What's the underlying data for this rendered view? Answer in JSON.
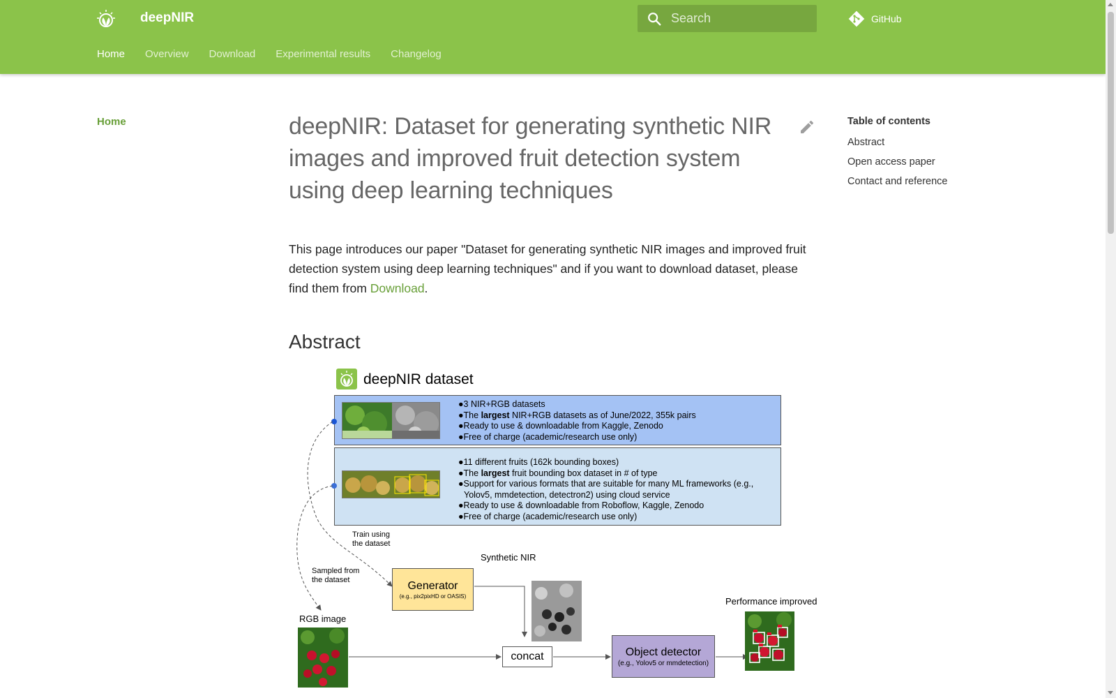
{
  "header": {
    "site_title": "deepNIR",
    "search_placeholder": "Search",
    "github_label": "GitHub",
    "tabs": [
      {
        "label": "Home",
        "active": true
      },
      {
        "label": "Overview",
        "active": false
      },
      {
        "label": "Download",
        "active": false
      },
      {
        "label": "Experimental results",
        "active": false
      },
      {
        "label": "Changelog",
        "active": false
      }
    ]
  },
  "nav": {
    "home_label": "Home"
  },
  "main": {
    "title": "deepNIR: Dataset for generating synthetic NIR images and improved fruit detection system using deep learning techniques",
    "intro_text": "This page introduces our paper \"Dataset for generating synthetic NIR images and improved fruit detection system using deep learning techniques\" and if you want to download dataset, please find them from ",
    "intro_link": "Download",
    "intro_end": ".",
    "abstract_heading": "Abstract"
  },
  "figure": {
    "title": "deepNIR dataset",
    "box1": [
      {
        "pre": "●3 NIR+RGB datasets",
        "bold": "",
        "post": ""
      },
      {
        "pre": "●The ",
        "bold": "largest",
        "post": " NIR+RGB datasets as of June/2022, 355k pairs"
      },
      {
        "pre": "●Ready to use & downloadable from Kaggle, Zenodo",
        "bold": "",
        "post": ""
      },
      {
        "pre": "●Free of charge (academic/research use only)",
        "bold": "",
        "post": ""
      }
    ],
    "box2": [
      {
        "pre": "●11 different fruits (162k bounding boxes)",
        "bold": "",
        "post": ""
      },
      {
        "pre": "●The ",
        "bold": "largest",
        "post": " fruit bounding box dataset in # of type"
      },
      {
        "pre": "●Support for various formats that are suitable for many ML frameworks (e.g.,",
        "bold": "",
        "post": ""
      },
      {
        "pre": "  Yolov5, mmdetection, detectron2) using cloud service",
        "bold": "",
        "post": ""
      },
      {
        "pre": "●Ready to use & downloadable from Roboflow, Kaggle, Zenodo",
        "bold": "",
        "post": ""
      },
      {
        "pre": "●Free of charge (academic/research use only)",
        "bold": "",
        "post": ""
      }
    ],
    "train_label_1": "Train using",
    "train_label_2": "the dataset",
    "sampled_label_1": "Sampled from",
    "sampled_label_2": "the dataset",
    "synthetic_label": "Synthetic NIR",
    "generator_title": "Generator",
    "generator_sub": "(e.g., pix2pixHD or OASIS)",
    "rgb_label": "RGB image",
    "concat_label": "concat",
    "detector_title": "Object detector",
    "detector_sub": "(e.g., Yolov5 or mmdetection)",
    "performance_label": "Performance improved"
  },
  "toc": {
    "title": "Table of contents",
    "items": [
      "Abstract",
      "Open access paper",
      "Contact and reference"
    ]
  },
  "colors": {
    "primary": "#8bc34a",
    "link": "#689f38",
    "box1": "#a4c2f4",
    "box2": "#cfe2f3",
    "generator": "#ffe599",
    "detector": "#b4a7d6"
  }
}
